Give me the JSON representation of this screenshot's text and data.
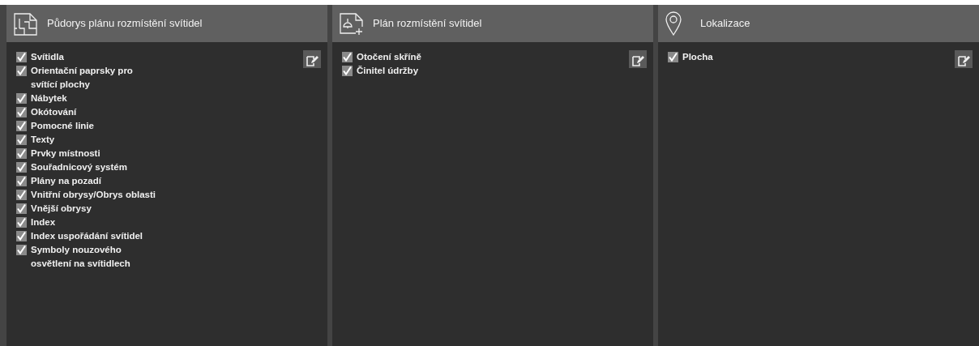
{
  "panels": [
    {
      "kind": "floorplan",
      "title": "Půdorys plánu rozmístění svítidel",
      "items": [
        {
          "label": "Svítidla",
          "checked": true
        },
        {
          "label": "Orientační paprsky pro\nsvítící plochy",
          "checked": true
        },
        {
          "label": "Nábytek",
          "checked": true
        },
        {
          "label": "Okótování",
          "checked": true
        },
        {
          "label": "Pomocné linie",
          "checked": true
        },
        {
          "label": "Texty",
          "checked": true
        },
        {
          "label": "Prvky místnosti",
          "checked": true
        },
        {
          "label": "Souřadnicový systém",
          "checked": true
        },
        {
          "label": "Plány na pozadí",
          "checked": true
        },
        {
          "label": "Vnitřní obrysy/Obrys oblasti",
          "checked": true
        },
        {
          "label": "Vnější obrysy",
          "checked": true
        },
        {
          "label": "Index",
          "checked": true
        },
        {
          "label": "Index uspořádání svítidel",
          "checked": true
        },
        {
          "label": "Symboly nouzového\nosvětlení na svítidlech",
          "checked": true
        }
      ]
    },
    {
      "kind": "lampplan",
      "title": "Plán rozmístění svítidel",
      "items": [
        {
          "label": "Otočení skříně",
          "checked": true
        },
        {
          "label": "Činitel údržby",
          "checked": true
        }
      ]
    },
    {
      "kind": "location",
      "title": "Lokalizace",
      "items": [
        {
          "label": "Plocha",
          "checked": true
        }
      ]
    }
  ]
}
